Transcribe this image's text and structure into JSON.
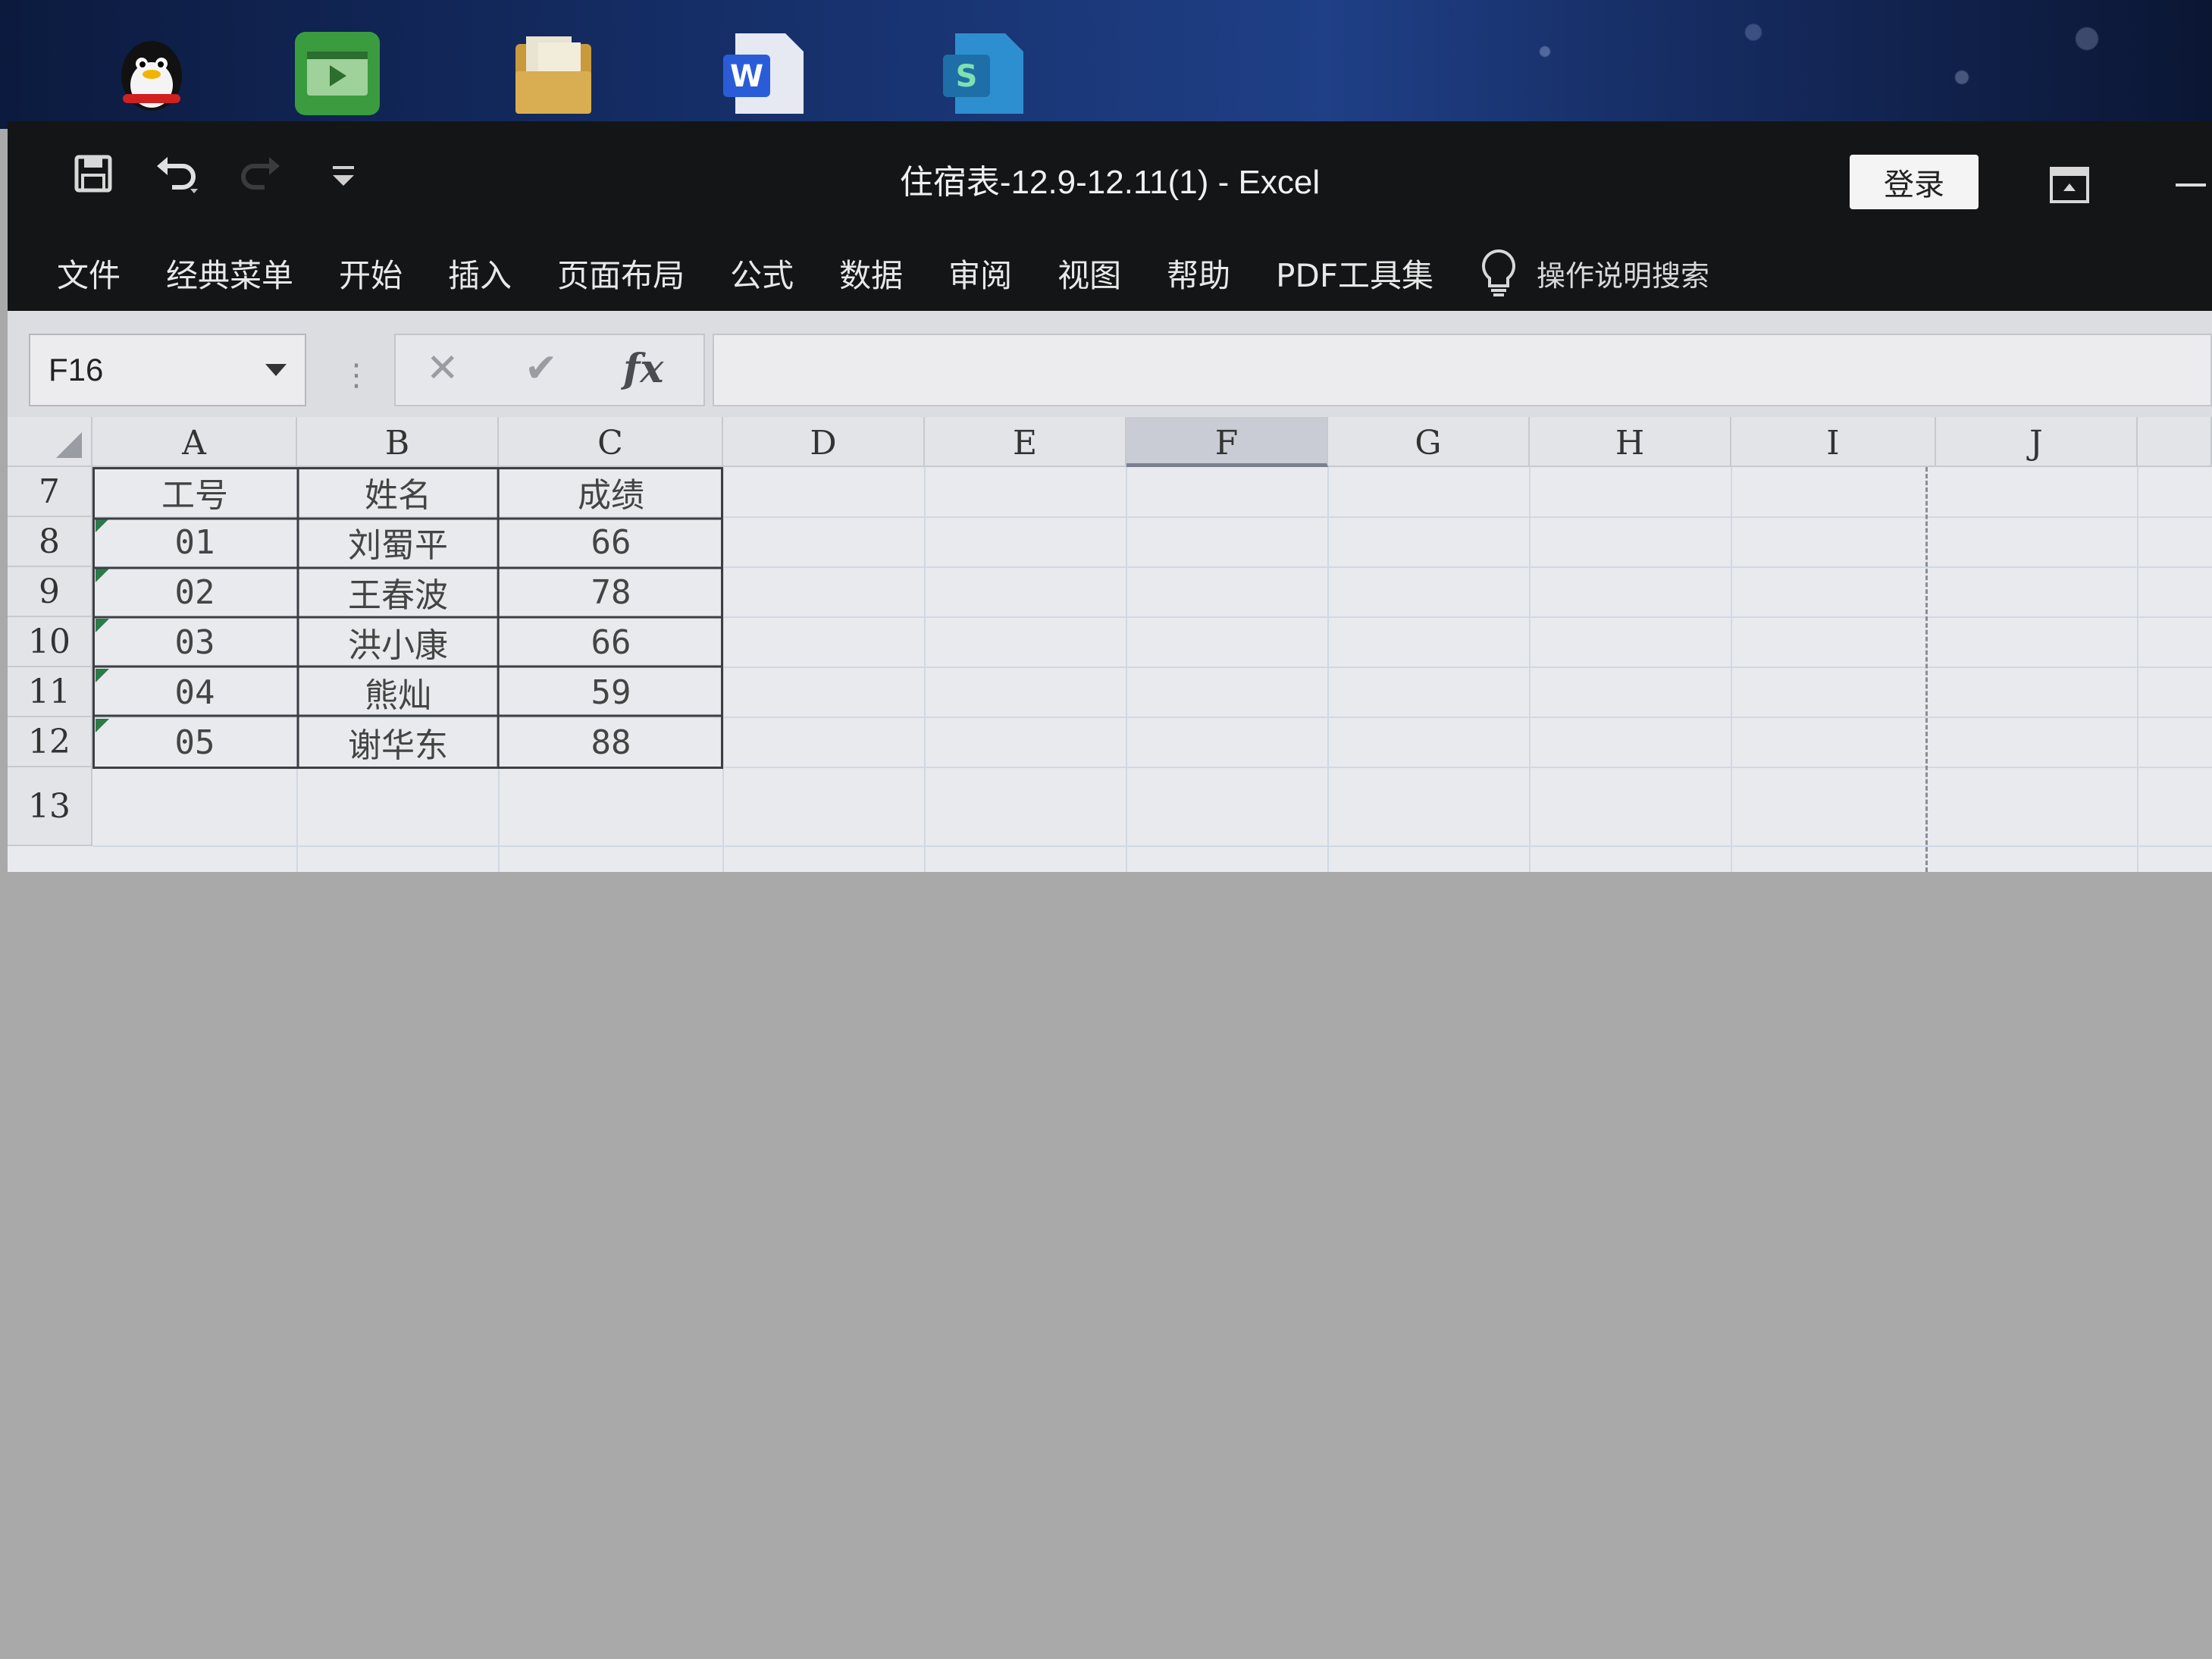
{
  "desktop": {
    "icons": [
      "qq-icon",
      "video-editor-icon",
      "folder-icon",
      "wps-writer-icon",
      "wps-spreadsheet-icon"
    ]
  },
  "title_bar": {
    "document_title": "住宿表-12.9-12.11(1)  -  Excel",
    "login_label": "登录",
    "qat_icons": [
      "save-icon",
      "undo-icon",
      "redo-icon",
      "customize-qat-icon"
    ]
  },
  "ribbon": {
    "tabs": [
      "文件",
      "经典菜单",
      "开始",
      "插入",
      "页面布局",
      "公式",
      "数据",
      "审阅",
      "视图",
      "帮助",
      "PDF工具集"
    ],
    "tell_me_label": "操作说明搜索"
  },
  "formula_bar": {
    "name_box": "F16",
    "cancel_glyph": "✕",
    "enter_glyph": "✔",
    "fx_glyph": "fx",
    "formula_value": ""
  },
  "sheet": {
    "columns": [
      "A",
      "B",
      "C",
      "D",
      "E",
      "F",
      "G",
      "H",
      "I",
      "J"
    ],
    "selected_column": "F",
    "row_numbers": [
      "7",
      "8",
      "9",
      "10",
      "11",
      "12",
      "13"
    ],
    "header_row": [
      "工号",
      "姓名",
      "成绩"
    ],
    "rows": [
      [
        "01",
        "刘蜀平",
        "66"
      ],
      [
        "02",
        "王春波",
        "78"
      ],
      [
        "03",
        "洪小康",
        "66"
      ],
      [
        "04",
        "熊灿",
        "59"
      ],
      [
        "05",
        "谢华东",
        "88"
      ]
    ]
  },
  "colors": {
    "title_bar": "#141516",
    "formula_bar": "#dcdde1",
    "grid_background": "#e9eaed",
    "gridline": "#cfd8e6",
    "error_indicator": "#2c7a4a"
  }
}
